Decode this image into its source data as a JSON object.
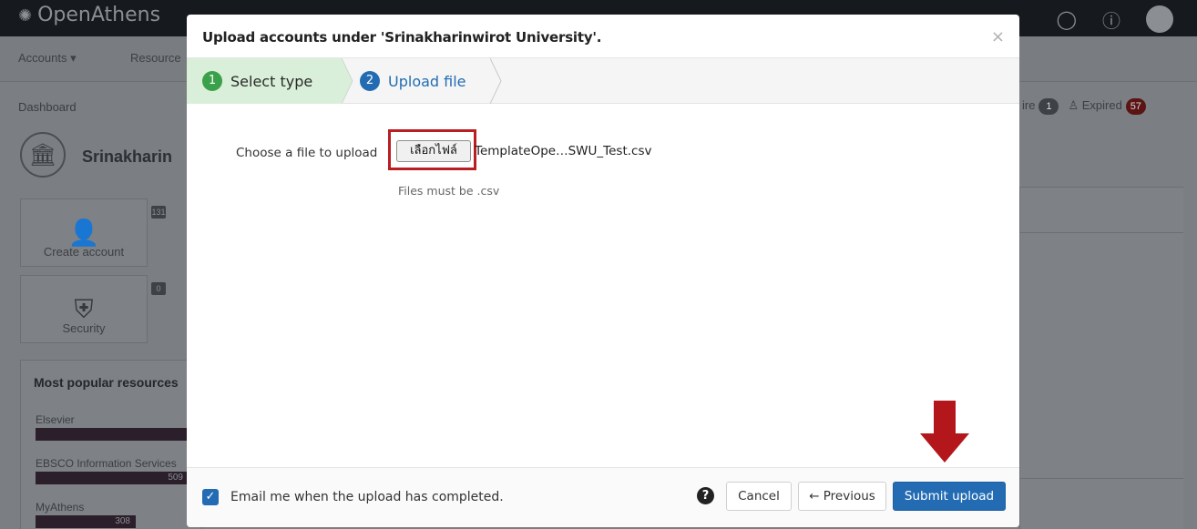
{
  "background": {
    "logo": "OpenAthens",
    "nav": {
      "accounts": "Accounts ▾",
      "resources": "Resource"
    },
    "breadcrumb": "Dashboard",
    "org_name": "Srinakharin",
    "tiles": [
      {
        "label": "Create account",
        "icon": "user-plus-icon",
        "badge": "131"
      },
      {
        "label": "Security",
        "icon": "shield-icon",
        "badge": "0"
      }
    ],
    "popular": {
      "title": "Most popular resources",
      "items": [
        {
          "name": "Elsevier",
          "count": ""
        },
        {
          "name": "EBSCO Information Services",
          "count": "509"
        },
        {
          "name": "MyAthens",
          "count": "308"
        }
      ]
    },
    "statuses": {
      "expire_label": "ire",
      "expire_count": "1",
      "expired_label": "♙ Expired",
      "expired_count": "57"
    }
  },
  "modal": {
    "title": "Upload accounts under 'Srinakharinwirot University'.",
    "close": "×",
    "steps": [
      {
        "number": "1",
        "label": "Select type",
        "state": "done"
      },
      {
        "number": "2",
        "label": "Upload file",
        "state": "active"
      }
    ],
    "file": {
      "label": "Choose a file to upload",
      "button": "เลือกไฟล์",
      "filename": "TemplateOpe…SWU_Test.csv",
      "help": "Files must be .csv"
    },
    "footer": {
      "email_checked": true,
      "email_label": "Email me when the upload has completed.",
      "help_icon": "?",
      "cancel": "Cancel",
      "previous": "← Previous",
      "submit": "Submit upload"
    }
  },
  "colors": {
    "primary": "#236cb3",
    "success": "#3aa14a",
    "step_done_bg": "#d9efd9",
    "highlight": "#b81e22",
    "annotation_arrow": "#b3171c"
  }
}
